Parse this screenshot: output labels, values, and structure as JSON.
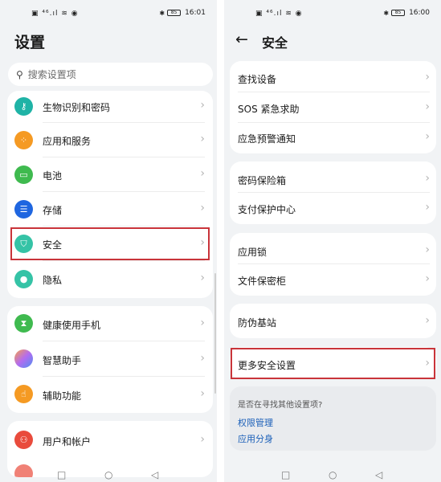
{
  "left": {
    "status": {
      "signal": "⁴⁶.ıl",
      "wifi": "≋",
      "battery": "85",
      "time": "16:01"
    },
    "title": "设置",
    "search_placeholder": "搜索设置项",
    "groups": [
      {
        "items": [
          {
            "label": "生物识别和密码",
            "icon": "key-icon",
            "color": "#1fb3a6"
          },
          {
            "label": "应用和服务",
            "icon": "apps-icon",
            "color": "#f59a23"
          },
          {
            "label": "电池",
            "icon": "battery-icon",
            "color": "#3fba4f"
          },
          {
            "label": "存储",
            "icon": "storage-icon",
            "color": "#1f66e0"
          },
          {
            "label": "安全",
            "icon": "shield-icon",
            "color": "#35c3a6"
          },
          {
            "label": "隐私",
            "icon": "privacy-icon",
            "color": "#35c3a6"
          }
        ]
      },
      {
        "items": [
          {
            "label": "健康使用手机",
            "icon": "hourglass-icon",
            "color": "#3fba4f"
          },
          {
            "label": "智慧助手",
            "icon": "assistant-icon",
            "color": "#b36cf0"
          },
          {
            "label": "辅助功能",
            "icon": "hand-icon",
            "color": "#f59a23"
          }
        ]
      },
      {
        "items": [
          {
            "label": "用户和帐户",
            "icon": "user-icon",
            "color": "#e94b3c"
          }
        ]
      }
    ]
  },
  "right": {
    "status": {
      "signal": "⁴⁶.ıl",
      "wifi": "≋",
      "battery": "85",
      "time": "16:00"
    },
    "title": "安全",
    "groups": [
      {
        "items": [
          "查找设备",
          "SOS 紧急求助",
          "应急预警通知"
        ]
      },
      {
        "items": [
          "密码保险箱",
          "支付保护中心"
        ]
      },
      {
        "items": [
          "应用锁",
          "文件保密柜"
        ]
      },
      {
        "items": [
          "防伪基站"
        ]
      },
      {
        "items": [
          "更多安全设置"
        ]
      }
    ],
    "suggest": {
      "question": "是否在寻找其他设置项?",
      "links": [
        "权限管理",
        "应用分身"
      ]
    }
  },
  "colors": {
    "highlight": "#c9343a",
    "link": "#1a5fb8"
  }
}
